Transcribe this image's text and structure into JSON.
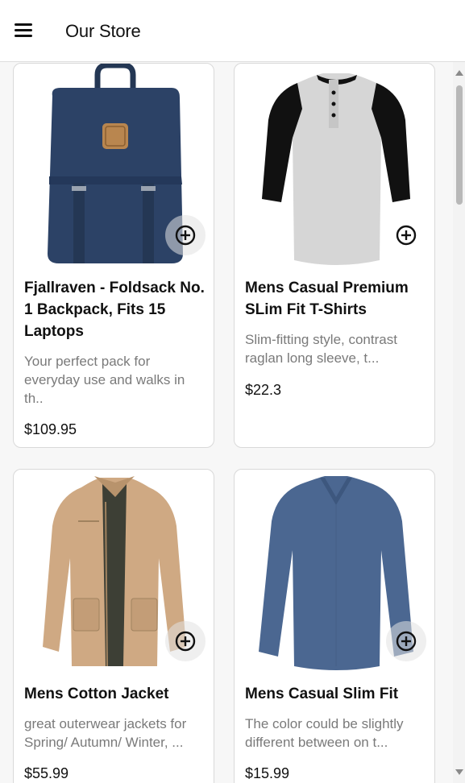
{
  "header": {
    "title": "Our Store",
    "menu_icon": "hamburger-menu-icon"
  },
  "products": [
    {
      "name": "Fjallraven - Foldsack No. 1 Backpack, Fits 15 Laptops",
      "description": "Your perfect pack for everyday use and walks in th..",
      "price": "$109.95",
      "image": "navy backpack"
    },
    {
      "name": "Mens Casual Premium SLim Fit T-Shirts",
      "description": "Slim-fitting style, contrast raglan long sleeve, t...",
      "price": "$22.3",
      "image": "grey and black raglan henley shirt"
    },
    {
      "name": "Mens Cotton Jacket",
      "description": "great outerwear jackets for Spring/ Autumn/ Winter, ...",
      "price": "$55.99",
      "image": "khaki cotton jacket"
    },
    {
      "name": "Mens Casual Slim Fit",
      "description": "The color could be slightly different between on t...",
      "price": "$15.99",
      "image": "blue long sleeve v-neck shirt"
    }
  ],
  "add_icon": "add-circle-icon",
  "colors": {
    "background": "#f7f7f7",
    "card": "#ffffff",
    "border": "#d9d9d9",
    "muted_text": "#7a7a7a"
  }
}
